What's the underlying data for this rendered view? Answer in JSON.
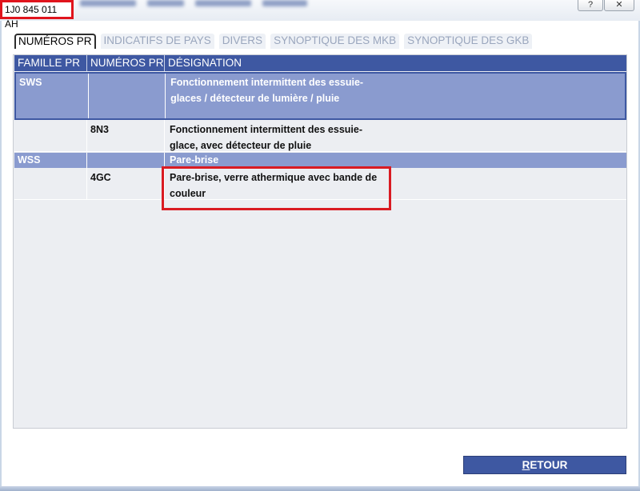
{
  "window": {
    "part_number": "1J0 845 011 AH",
    "help_label": "?",
    "close_label": "✕"
  },
  "tabs": [
    {
      "label": "NUMÉROS PR",
      "active": true
    },
    {
      "label": "INDICATIFS DE PAYS",
      "active": false
    },
    {
      "label": "DIVERS",
      "active": false
    },
    {
      "label": "SYNOPTIQUE DES MKB",
      "active": false
    },
    {
      "label": "SYNOPTIQUE DES GKB",
      "active": false
    }
  ],
  "table": {
    "headers": [
      "FAMILLE PR",
      "NUMÉROS PR",
      "DÉSIGNATION"
    ],
    "rows": [
      {
        "famille": "SWS",
        "numero": "",
        "designation": "Fonctionnement intermittent des essuie-glaces / détecteur de lumière / pluie"
      },
      {
        "famille": "",
        "numero": "8N3",
        "designation": "Fonctionnement intermittent des essuie-glace, avec détecteur de pluie"
      },
      {
        "famille": "WSS",
        "numero": "",
        "designation": "Pare-brise"
      },
      {
        "famille": "",
        "numero": "4GC",
        "designation": "Pare-brise, verre athermique avec bande de couleur"
      }
    ]
  },
  "footer": {
    "retour_first": "R",
    "retour_rest": "ETOUR"
  },
  "colors": {
    "header_bg": "#3e58a2",
    "family_row_bg": "#8a9bcf",
    "highlight_box": "#d91b22"
  }
}
